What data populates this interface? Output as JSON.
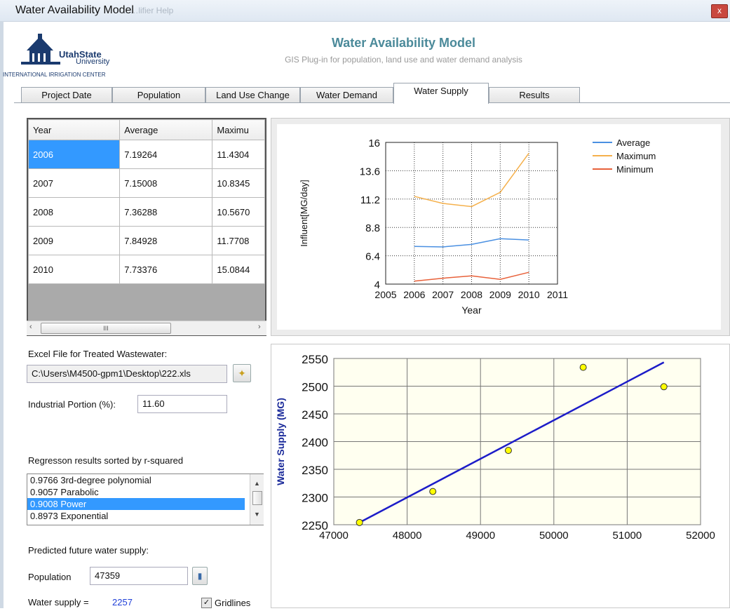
{
  "window": {
    "title": "Water Availability Model",
    "ghost_menu": "…         …lifier      Help",
    "close_glyph": "x"
  },
  "header": {
    "logo_line1": "UtahState",
    "logo_line2": "University",
    "logo_line3": "INTERNATIONAL IRRIGATION CENTER",
    "title": "Water Availability  Model",
    "subtitle": "GIS Plug-in for population, land use and water demand analysis"
  },
  "tabs": [
    {
      "label": "Project Date"
    },
    {
      "label": "Population"
    },
    {
      "label": "Land Use Change"
    },
    {
      "label": "Water Demand"
    },
    {
      "label": "Water Supply"
    },
    {
      "label": "Results"
    }
  ],
  "grid": {
    "headers": [
      "Year",
      "Average",
      "Maximu"
    ],
    "rows": [
      [
        "2006",
        "7.19264",
        "11.4304"
      ],
      [
        "2007",
        "7.15008",
        "10.8345"
      ],
      [
        "2008",
        "7.36288",
        "10.5670"
      ],
      [
        "2009",
        "7.84928",
        "11.7708"
      ],
      [
        "2010",
        "7.73376",
        "15.0844"
      ]
    ],
    "scroll_thumb": "III",
    "scroll_left": "‹",
    "scroll_right": "›"
  },
  "form": {
    "excel_label": "Excel File for Treated Wastewater:",
    "excel_path": "C:\\Users\\M4500-gpm1\\Desktop\\222.xls",
    "industrial_label": "Industrial Portion (%):",
    "industrial_value": "11.60",
    "regression_label": "Regresson results sorted by r-squared",
    "regression_items": [
      {
        "text": "0.9766  3rd-degree polynomial"
      },
      {
        "text": "0.9057  Parabolic"
      },
      {
        "text": "0.9008  Power"
      },
      {
        "text": "0.8973  Exponential"
      }
    ],
    "predicted_label": "Predicted future water supply:",
    "population_label": "Population",
    "population_value": "47359",
    "water_supply_label": "Water supply =",
    "water_supply_value": "2257",
    "gridlines_label": "Gridlines"
  },
  "chart_data": [
    {
      "type": "line",
      "ylabel": "Influent[MG/day]",
      "xlabel": "Year",
      "xlim": [
        2005,
        2011
      ],
      "ylim": [
        4,
        16
      ],
      "xticks": [
        "2005",
        "2006",
        "2007",
        "2008",
        "2009",
        "2010",
        "2011"
      ],
      "yticks": [
        "4",
        "6.4",
        "8.8",
        "11.2",
        "13.6",
        "16"
      ],
      "grid": true,
      "legend_position": "right",
      "x": [
        2006,
        2007,
        2008,
        2009,
        2010
      ],
      "series": [
        {
          "name": "Average",
          "color": "#4a90e2",
          "values": [
            7.19264,
            7.15008,
            7.36288,
            7.84928,
            7.73376
          ]
        },
        {
          "name": "Maximum",
          "color": "#f5b04b",
          "values": [
            11.4304,
            10.8345,
            10.567,
            11.7708,
            15.0844
          ]
        },
        {
          "name": "Minimum",
          "color": "#e8613a",
          "values": [
            4.25,
            4.5,
            4.7,
            4.4,
            5.0
          ]
        }
      ]
    },
    {
      "type": "scatter",
      "ylabel": "Water Supply (MG)",
      "xlim": [
        47000,
        52000
      ],
      "ylim": [
        2250,
        2550
      ],
      "xticks": [
        "47000",
        "48000",
        "49000",
        "50000",
        "51000",
        "52000"
      ],
      "yticks": [
        "2250",
        "2300",
        "2350",
        "2400",
        "2450",
        "2500",
        "2550"
      ],
      "grid": true,
      "points": [
        {
          "x": 47350,
          "y": 2254
        },
        {
          "x": 48350,
          "y": 2310
        },
        {
          "x": 49380,
          "y": 2384
        },
        {
          "x": 50400,
          "y": 2534
        },
        {
          "x": 51500,
          "y": 2499
        }
      ],
      "fit_line": {
        "x": [
          47350,
          51500
        ],
        "y": [
          2254,
          2543
        ]
      },
      "point_color": "#ffff00",
      "line_color": "#1c1cc8",
      "plot_background": "#fffff0"
    }
  ]
}
